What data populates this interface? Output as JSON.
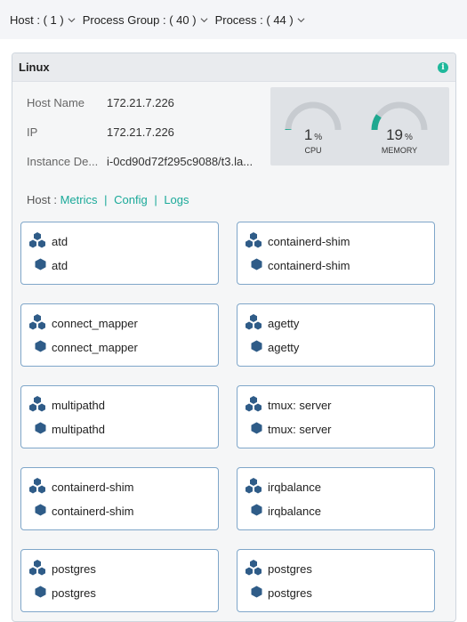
{
  "filters": [
    {
      "label": "Host : ( 1 )"
    },
    {
      "label": "Process Group : ( 40 )"
    },
    {
      "label": "Process : ( 44 )"
    }
  ],
  "panel": {
    "title": "Linux",
    "info_icon": "info-icon"
  },
  "properties": [
    {
      "key": "Host Name",
      "value": "172.21.7.226"
    },
    {
      "key": "IP",
      "value": "172.21.7.226"
    },
    {
      "key": "Instance De...",
      "value": "i-0cd90d72f295c9088/t3.la..."
    }
  ],
  "gauges": [
    {
      "value": "1",
      "unit": "%",
      "label": "CPU",
      "fraction": 0.01,
      "color": "#1fa890"
    },
    {
      "value": "19",
      "unit": "%",
      "label": "MEMORY",
      "fraction": 0.19,
      "color": "#1fa890"
    }
  ],
  "host_links": {
    "prefix": "Host : ",
    "metrics": "Metrics",
    "sep1": "|",
    "config": "Config",
    "sep2": "|",
    "logs": "Logs"
  },
  "processes": [
    {
      "group": "atd",
      "process": "atd"
    },
    {
      "group": "containerd-shim",
      "process": "containerd-shim"
    },
    {
      "group": "connect_mapper",
      "process": "connect_mapper"
    },
    {
      "group": "agetty",
      "process": "agetty"
    },
    {
      "group": "multipathd",
      "process": "multipathd"
    },
    {
      "group": "tmux: server",
      "process": "tmux: server"
    },
    {
      "group": "containerd-shim",
      "process": "containerd-shim"
    },
    {
      "group": "irqbalance",
      "process": "irqbalance"
    },
    {
      "group": "postgres",
      "process": "postgres"
    },
    {
      "group": "postgres",
      "process": "postgres"
    }
  ],
  "colors": {
    "accent": "#1aa999",
    "card_border": "#7fa6c9",
    "icon": "#2f5c88"
  }
}
